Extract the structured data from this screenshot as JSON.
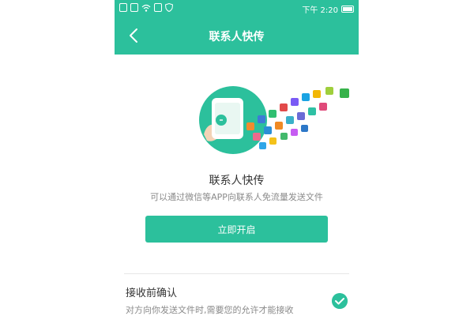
{
  "status_bar": {
    "time": "下午 2:20"
  },
  "nav": {
    "title": "联系人快传"
  },
  "feature": {
    "title": "联系人快传",
    "description": "可以通过微信等APP向联系人免流量发送文件",
    "enable_button": "立即开启"
  },
  "setting": {
    "label": "接收前确认",
    "description": "对方向你发送文件时,需要您的允许才能接收",
    "checked": true
  },
  "colors": {
    "accent": "#2cc09c",
    "text_primary": "#333333",
    "text_secondary": "#8a8a8a"
  }
}
